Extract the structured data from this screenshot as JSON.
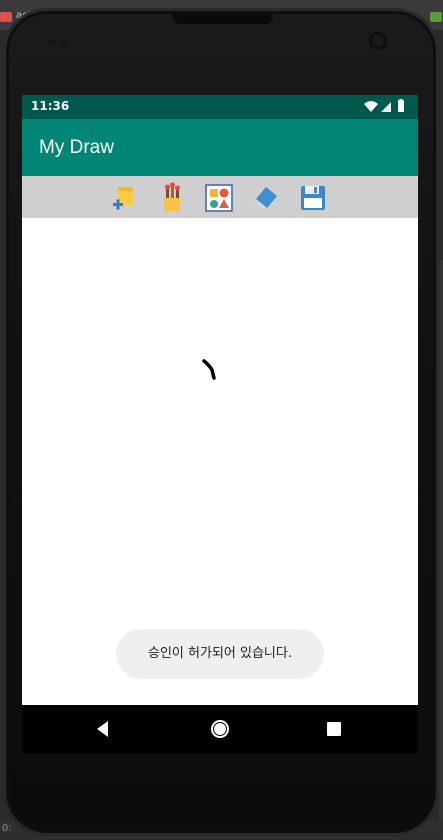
{
  "ide": {
    "tab_text": "acti",
    "bottom_text": "0:"
  },
  "status_bar": {
    "time": "11:36"
  },
  "app": {
    "title": "My Draw"
  },
  "toolbar": {
    "tools": [
      {
        "name": "new-file-icon"
      },
      {
        "name": "brush-cup-icon"
      },
      {
        "name": "shapes-icon"
      },
      {
        "name": "eraser-icon"
      },
      {
        "name": "save-icon"
      }
    ]
  },
  "toast": {
    "message": "승인이 허가되어 있습니다."
  },
  "colors": {
    "status_bar": "#00574b",
    "app_bar": "#008577",
    "toolbar": "#cfcfcf",
    "toast_bg": "#efefef",
    "nav_bar": "#000000"
  }
}
